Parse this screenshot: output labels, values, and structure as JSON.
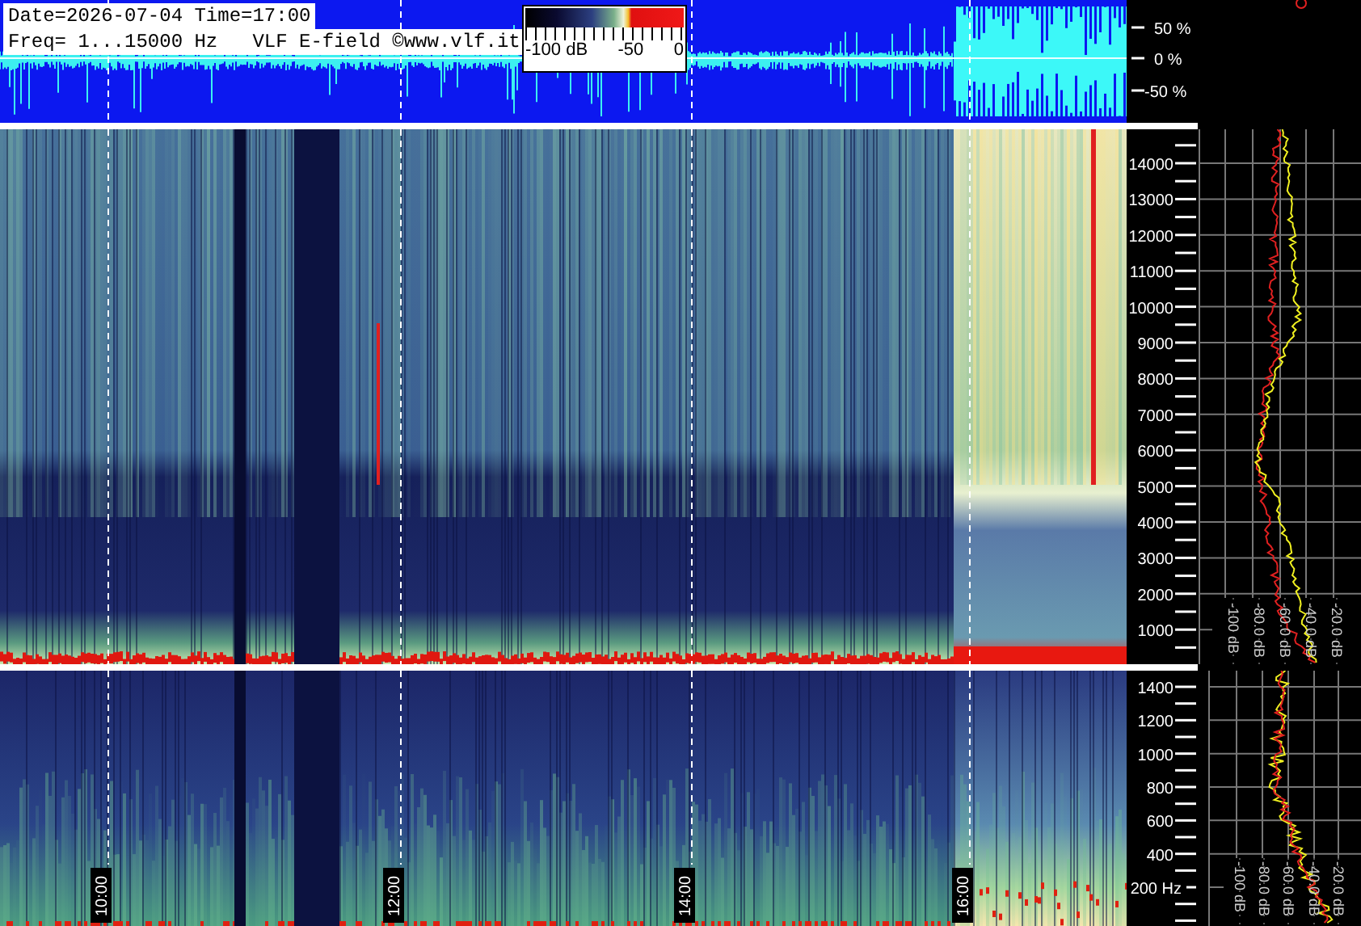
{
  "header": {
    "date_line": "Date=2026-07-04 Time=17:00",
    "freq_line": "Freq= 1...15000 Hz   VLF E-field ©www.vlf.it"
  },
  "color_scale": {
    "labels": [
      "-100 dB",
      "-50",
      "0"
    ]
  },
  "waveform_axis": [
    "50 %",
    "0 %",
    "-50 %"
  ],
  "spectrogram_axis": [
    "14000",
    "13000",
    "12000",
    "11000",
    "10000",
    "9000",
    "8000",
    "7000",
    "6000",
    "5000",
    "4000",
    "3000",
    "2000",
    "1000"
  ],
  "spectrogram_db_axis": [
    "-100 dB",
    "-80.0 dB",
    "-60.0 dB",
    "-40.0 dB",
    "-20.0 dB"
  ],
  "lowfreq_axis": [
    "1400",
    "1200",
    "1000",
    "800",
    "600",
    "400",
    "200 Hz"
  ],
  "lowfreq_db_axis": [
    "-100 dB",
    "-80.0 dB",
    "-60.0 dB",
    "-40.0 dB",
    "-20.0 dB"
  ],
  "time_markers": [
    "10:00",
    "12:00",
    "14:00",
    "16:00"
  ]
}
